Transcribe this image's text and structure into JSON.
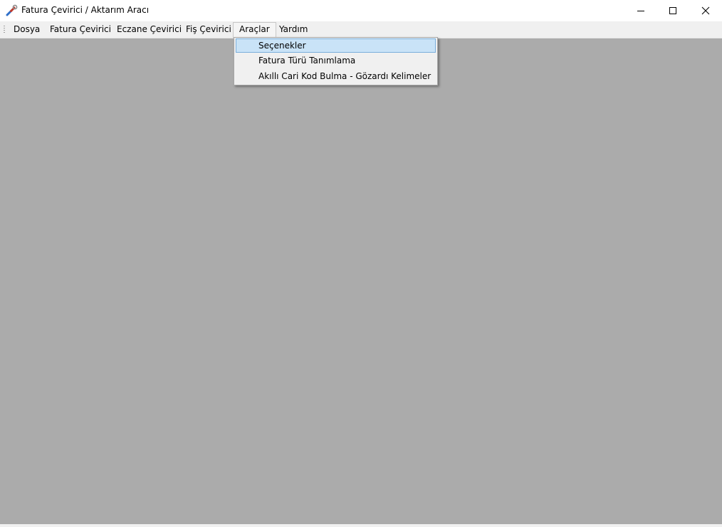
{
  "window": {
    "title": "Fatura Çevirici / Aktarım Aracı",
    "app_icon": "wrench-icon"
  },
  "menubar": {
    "items": [
      {
        "label": "Dosya"
      },
      {
        "label": "Fatura Çevirici"
      },
      {
        "label": "Eczane Çevirici"
      },
      {
        "label": "Fiş Çevirici"
      },
      {
        "label": "Araçlar",
        "open": true
      },
      {
        "label": "Yardım"
      }
    ]
  },
  "dropdown": {
    "parent": "Araçlar",
    "items": [
      {
        "label": "Seçenekler",
        "highlighted": true
      },
      {
        "label": "Fatura Türü Tanımlama"
      },
      {
        "label": "Akıllı Cari Kod Bulma - Gözardı Kelimeler"
      }
    ]
  },
  "colors": {
    "mdi_background": "#ababab",
    "menu_highlight": "#c9e3f7",
    "menu_highlight_border": "#7aaedb"
  }
}
